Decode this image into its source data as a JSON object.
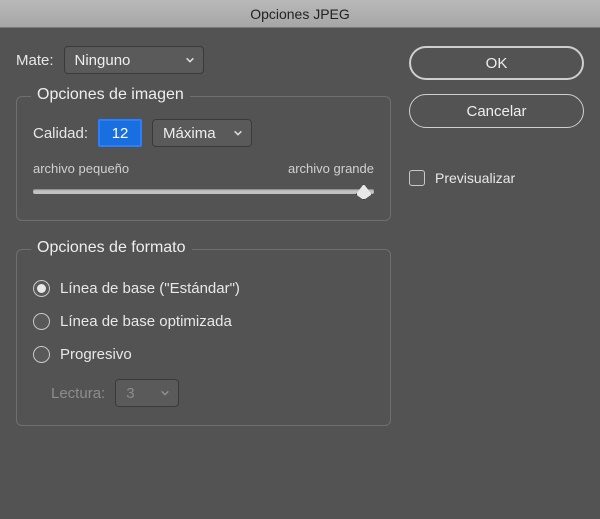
{
  "title": "Opciones JPEG",
  "matte": {
    "label": "Mate:",
    "value": "Ninguno"
  },
  "imageOptions": {
    "groupTitle": "Opciones de imagen",
    "qualityLabel": "Calidad:",
    "qualityValue": "12",
    "qualityPreset": "Máxima",
    "smallLabel": "archivo pequeño",
    "largeLabel": "archivo grande",
    "sliderPercent": 97
  },
  "formatOptions": {
    "groupTitle": "Opciones de formato",
    "baselineStandard": "Línea de base (\"Estándar\")",
    "baselineOptimized": "Línea de base optimizada",
    "progressive": "Progresivo",
    "scansLabel": "Lectura:",
    "scansValue": "3",
    "selected": "baselineStandard"
  },
  "buttons": {
    "ok": "OK",
    "cancel": "Cancelar"
  },
  "preview": {
    "label": "Previsualizar",
    "checked": false
  }
}
